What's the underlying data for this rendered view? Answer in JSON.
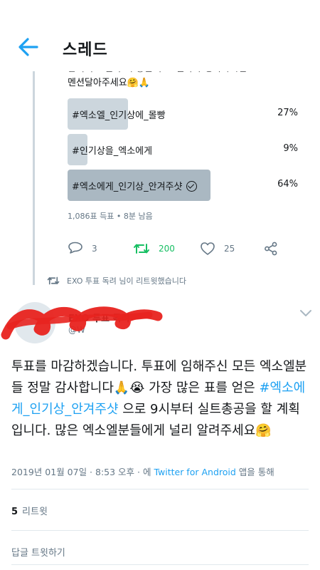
{
  "header": {
    "title": "스레드"
  },
  "poll_tweet": {
    "text_line1_partial": "팥의 투표결과 더 좋은 투표 결과가 생각나시면",
    "text_line2": "멘션달아주세요🤗🙏",
    "options": [
      {
        "label": "#엑소엘_인기상에_몰빵",
        "percent": "27%",
        "fraction": 0.27,
        "winner": false
      },
      {
        "label": "#인기상을_엑소에게",
        "percent": "9%",
        "fraction": 0.09,
        "winner": false
      },
      {
        "label": "#엑소에게_인기상_안겨주샷",
        "percent": "64%",
        "fraction": 0.64,
        "winner": true
      }
    ],
    "meta": "1,086표 득표 • 8분 남음",
    "actions": {
      "reply_count": "3",
      "retweet_count": "200",
      "like_count": "25"
    }
  },
  "retweet_note": "EXO 투표 독려 님이 리트윗했습니다",
  "author": {
    "name": "EXO 투표 독려",
    "handle": "@W"
  },
  "tweet": {
    "text_before": "투표를 마감하겠습니다. 투표에 임해주신 모든 엑소엘분들 정말 감사합니다🙏😭 가장 많은 표를 얻은 ",
    "hashtag": "#엑소에게_인기상_안겨주샷",
    "text_after": " 으로 9시부터 실트총공을 할 계획입니다. 많은 엑소엘분들에게 널리 알려주세요🤗",
    "timestamp": "2019년 01월 07일 · 8:53 오후 · 에 ",
    "source": "Twitter for Android",
    "source_suffix": " 앱을 통해"
  },
  "stats": {
    "retweet_count": "5",
    "retweet_label": "리트윗"
  },
  "reply_label": "답글 트윗하기",
  "colors": {
    "accent": "#1da1f2",
    "retweet_green": "#17bf63",
    "muted": "#657786",
    "scribble": "#e8231f"
  }
}
